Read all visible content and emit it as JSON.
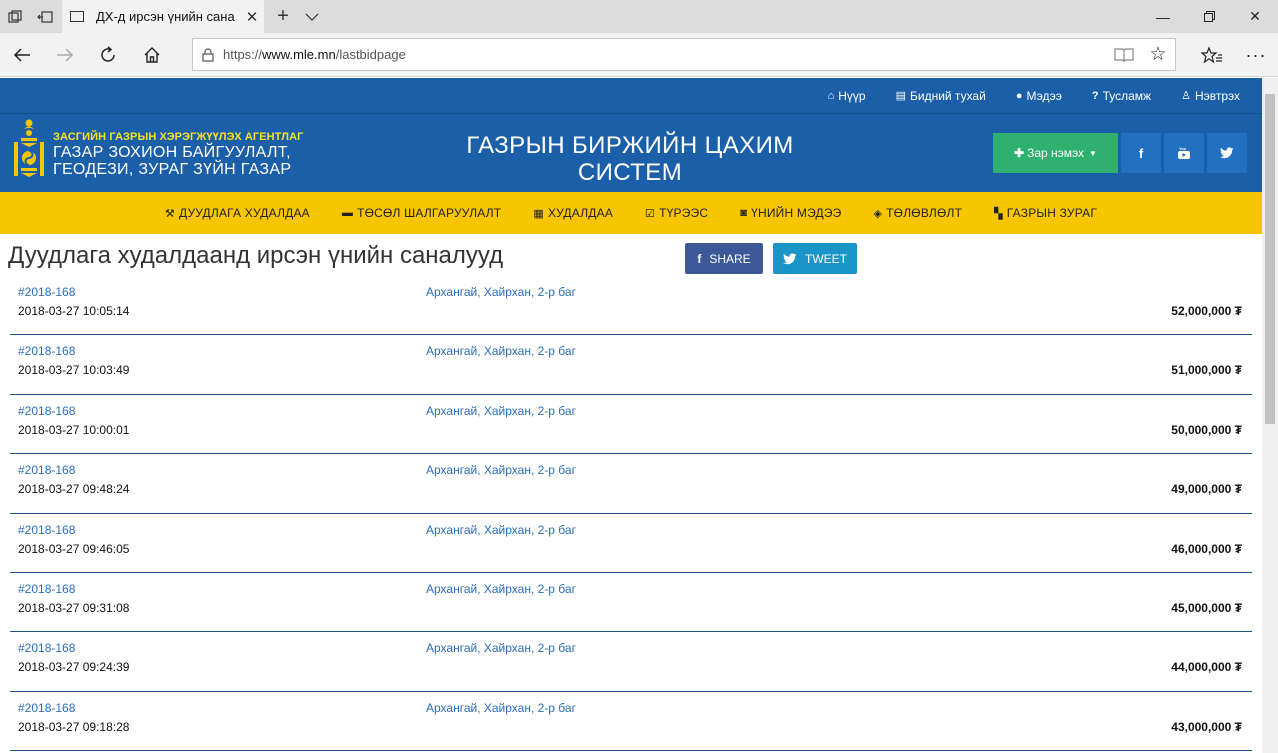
{
  "browser": {
    "tab_title": "ДХ-д ирсэн үнийн сана",
    "url_prefix": "https://",
    "url_host": "www.mle.mn",
    "url_path": "/lastbidpage"
  },
  "topnav": [
    {
      "icon": "home-icon",
      "glyph": "⌂",
      "label": "Нүүр"
    },
    {
      "icon": "card-icon",
      "glyph": "▤",
      "label": "Бидний тухай"
    },
    {
      "icon": "users-icon",
      "glyph": "●",
      "label": "Мэдээ"
    },
    {
      "icon": "question-icon",
      "glyph": "?",
      "label": "Тусламж"
    },
    {
      "icon": "user-icon",
      "glyph": "♙",
      "label": "Нэвтрэх"
    }
  ],
  "header": {
    "agency": "ЗАСГИЙН ГАЗРЫН ХЭРЭГЖҮҮЛЭХ АГЕНТЛАГ",
    "agency_line1": "ГАЗАР ЗОХИОН БАЙГУУЛАЛТ,",
    "agency_line2": "ГЕОДЕЗИ, ЗУРАГ ЗҮЙН ГАЗАР",
    "title_line1": "ГАЗРЫН БИРЖИЙН ЦАХИМ",
    "title_line2": "СИСТЕМ",
    "add_button": "Зар нэмэх",
    "facebook": "f",
    "youtube": "▶",
    "twitter": "🐦"
  },
  "catnav": [
    {
      "icon": "gavel-icon",
      "glyph": "⚒",
      "label": "ДУУДЛАГА ХУДАЛДАА"
    },
    {
      "icon": "money-icon",
      "glyph": "▬",
      "label": "ТӨСӨЛ ШАЛГАРУУЛАЛТ"
    },
    {
      "icon": "building-icon",
      "glyph": "▦",
      "label": "ХУДАЛДАА"
    },
    {
      "icon": "calendar-icon",
      "glyph": "☑",
      "label": "ТҮРЭЭС"
    },
    {
      "icon": "cash-icon",
      "glyph": "◙",
      "label": "ҮНИЙН МЭДЭЭ"
    },
    {
      "icon": "cube-icon",
      "glyph": "◈",
      "label": "ТӨЛӨВЛӨЛТ"
    },
    {
      "icon": "map-icon",
      "glyph": "▚",
      "label": "ГАЗРЫН ЗУРАГ"
    }
  ],
  "content": {
    "title": "Дуудлага худалдаанд ирсэн үнийн саналууд",
    "share": "SHARE",
    "tweet": "TWEET"
  },
  "bids": [
    {
      "lot": "#2018-168",
      "time": "2018-03-27 10:05:14",
      "location": "Архангай, Хайрхан, 2-р баг",
      "amount": "52,000,000 ₮"
    },
    {
      "lot": "#2018-168",
      "time": "2018-03-27 10:03:49",
      "location": "Архангай, Хайрхан, 2-р баг",
      "amount": "51,000,000 ₮"
    },
    {
      "lot": "#2018-168",
      "time": "2018-03-27 10:00:01",
      "location": "Архангай, Хайрхан, 2-р баг",
      "amount": "50,000,000 ₮"
    },
    {
      "lot": "#2018-168",
      "time": "2018-03-27 09:48:24",
      "location": "Архангай, Хайрхан, 2-р баг",
      "amount": "49,000,000 ₮"
    },
    {
      "lot": "#2018-168",
      "time": "2018-03-27 09:46:05",
      "location": "Архангай, Хайрхан, 2-р баг",
      "amount": "46,000,000 ₮"
    },
    {
      "lot": "#2018-168",
      "time": "2018-03-27 09:31:08",
      "location": "Архангай, Хайрхан, 2-р баг",
      "amount": "45,000,000 ₮"
    },
    {
      "lot": "#2018-168",
      "time": "2018-03-27 09:24:39",
      "location": "Архангай, Хайрхан, 2-р баг",
      "amount": "44,000,000 ₮"
    },
    {
      "lot": "#2018-168",
      "time": "2018-03-27 09:18:28",
      "location": "Архангай, Хайрхан, 2-р баг",
      "amount": "43,000,000 ₮"
    }
  ]
}
